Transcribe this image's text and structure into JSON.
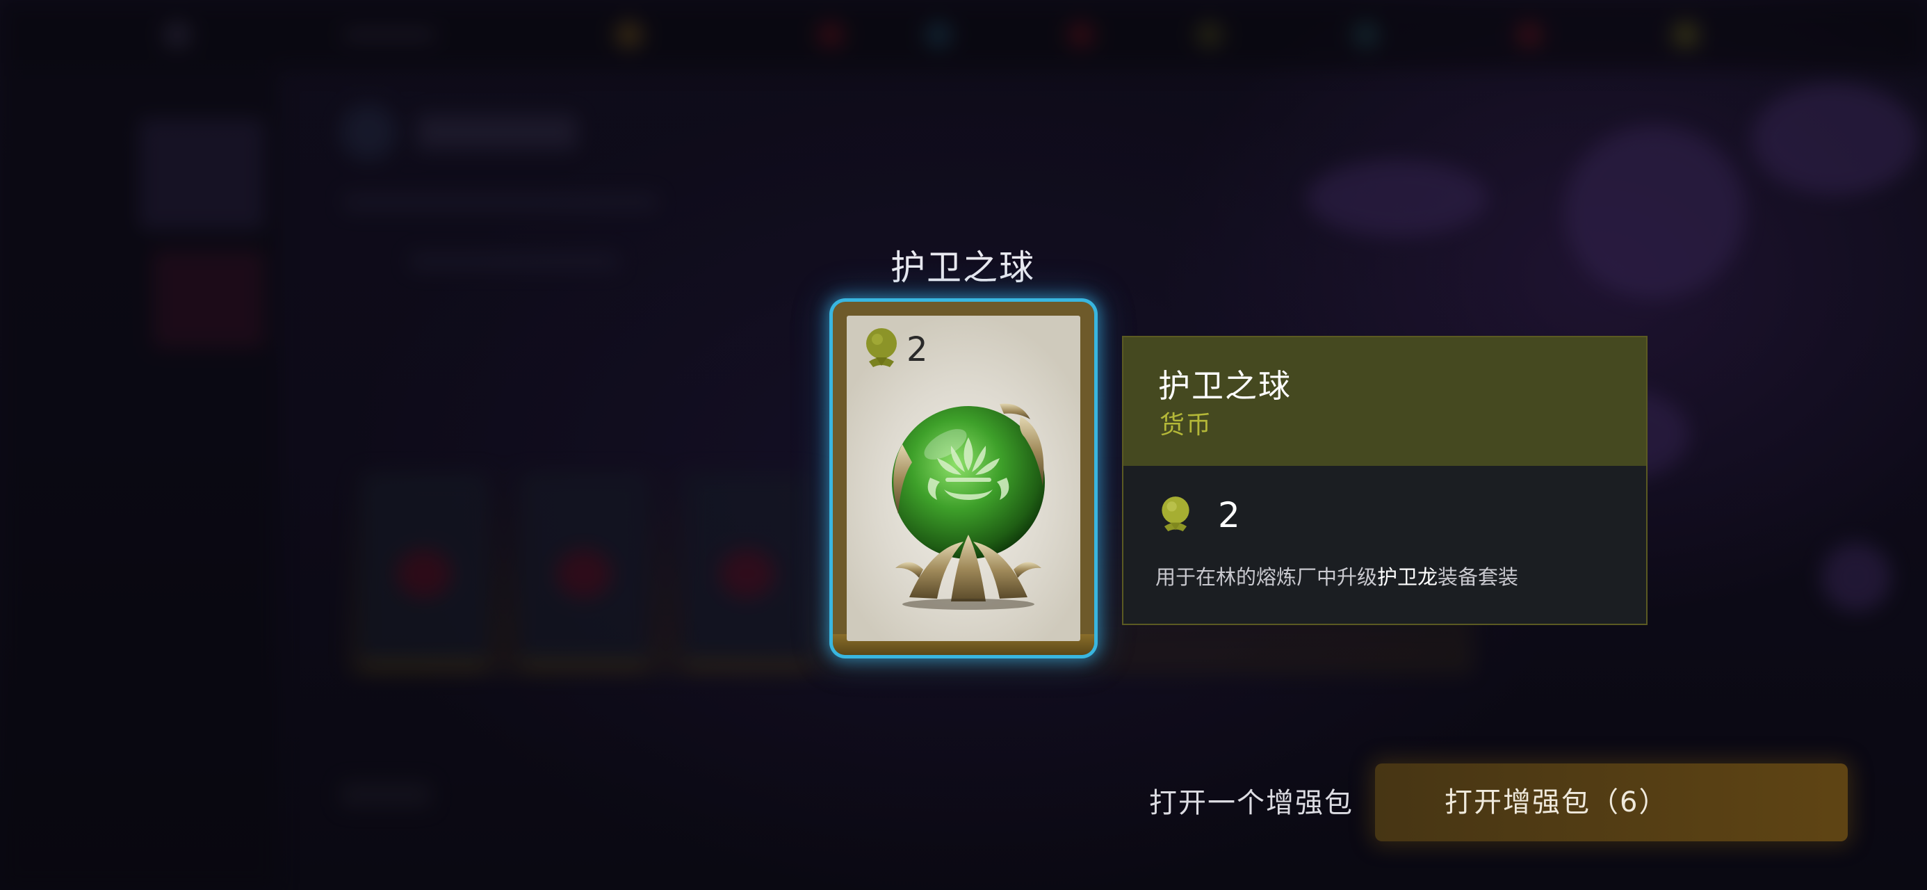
{
  "featured_card": {
    "name": "护卫之球",
    "cost": "2"
  },
  "info_panel": {
    "title": "护卫之球",
    "type": "货币",
    "cost": "2",
    "description_prefix": "用于在林的熔炼厂中升级",
    "description_highlight": "护卫龙",
    "description_suffix": "装备套装"
  },
  "actions": {
    "open_one_label": "打开一个增强包",
    "open_all_label": "打开增强包（6）"
  },
  "colors": {
    "card_glow": "#39b6e0",
    "info_header_bg": "#454920",
    "info_type_text": "#b4b838",
    "open_all_button": "#8a6414"
  },
  "icons": {
    "cost_icon": "orb-cost-icon",
    "card_art": "guardian-orb-art"
  }
}
